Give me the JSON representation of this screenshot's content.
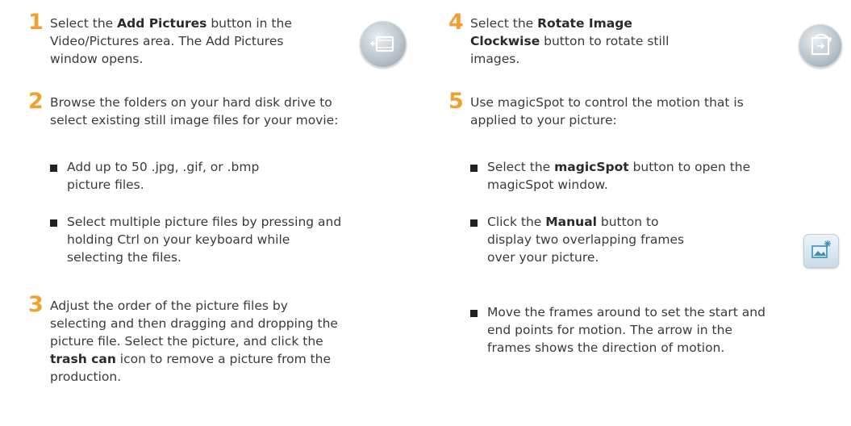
{
  "left": {
    "step1": {
      "number": "1",
      "line1_pre": "Select the ",
      "line1_bold": "Add Pictures",
      "line1_post": " button in the",
      "line2": "Video/Pictures area. The Add Pictures",
      "line3": "window opens.",
      "icon": "add-pictures-icon"
    },
    "step2": {
      "number": "2",
      "line1": "Browse the folders on your hard disk drive to",
      "line2": "select existing still image files for your movie:",
      "bullets": [
        {
          "l1": "Add up to 50 .jpg, .gif, or .bmp",
          "l2": "picture files."
        },
        {
          "l1": "Select multiple picture files by pressing and",
          "l2": "holding Ctrl on your keyboard while",
          "l3": "selecting the files."
        }
      ]
    },
    "step3": {
      "number": "3",
      "line1": "Adjust the order of the picture files by",
      "line2": "selecting and then dragging and dropping the",
      "line3": "picture file. Select the picture, and click the",
      "line4_bold": "trash can",
      "line4_post": " icon to remove a picture from the",
      "line5": "production."
    }
  },
  "right": {
    "step4": {
      "number": "4",
      "line1_pre": "Select the ",
      "line1_bold": "Rotate Image",
      "line2_bold": "Clockwise",
      "line2_post": " button to rotate still",
      "line3": "images.",
      "icon": "rotate-clockwise-icon"
    },
    "step5": {
      "number": "5",
      "line1": "Use magicSpot to control the motion that is",
      "line2": "applied to your picture:",
      "bullet1": {
        "pre": "Select the ",
        "bold": "magicSpot",
        "post": " button to open the",
        "l2": "magicSpot window."
      },
      "bullet2": {
        "pre": "Click the ",
        "bold": "Manual",
        "post": " button to",
        "l2": "display two overlapping frames",
        "l3": "over your picture.",
        "icon": "manual-frames-icon"
      },
      "bullet3": {
        "l1": "Move the frames around to set the start and",
        "l2": "end points for motion. The arrow in the",
        "l3": "frames shows the direction of motion."
      }
    }
  },
  "colors": {
    "step_number": "#f0a030",
    "text": "#3a3a3a"
  }
}
